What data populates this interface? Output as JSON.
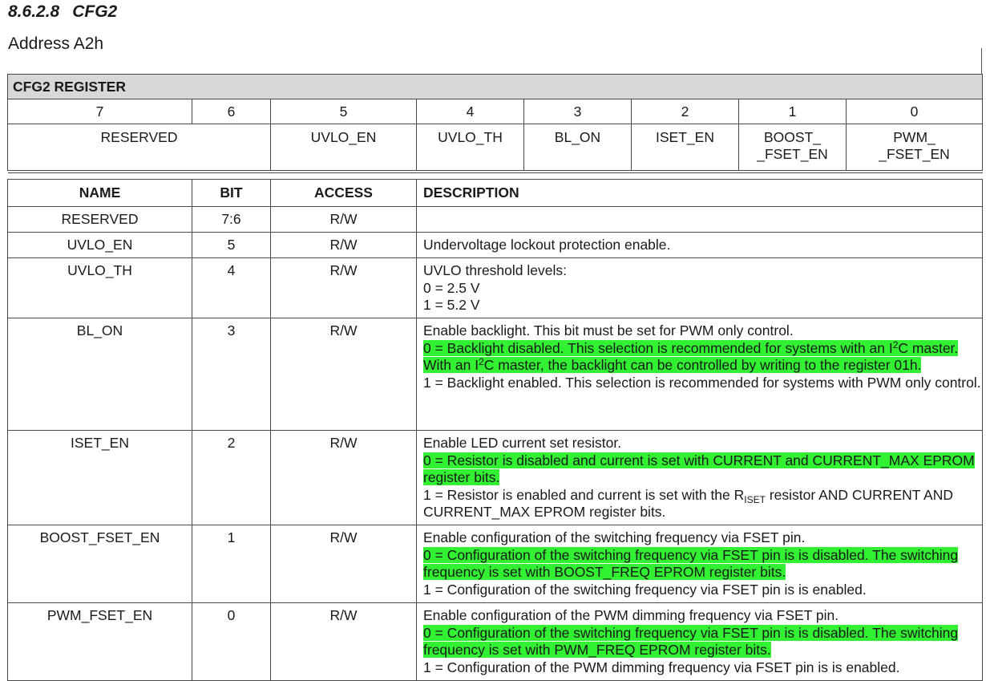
{
  "section": {
    "number": "8.6.2.8",
    "title": "CFG2"
  },
  "address": "Address A2h",
  "register": {
    "title": "CFG2 REGISTER",
    "bits": [
      "7",
      "6",
      "5",
      "4",
      "3",
      "2",
      "1",
      "0"
    ],
    "fields": {
      "reserved": "RESERVED",
      "b5": "UVLO_EN",
      "b4": "UVLO_TH",
      "b3": "BL_ON",
      "b2": "ISET_EN",
      "b1_line1": "BOOST_",
      "b1_line2": "_FSET_EN",
      "b0_line1": "PWM_",
      "b0_line2": "_FSET_EN"
    }
  },
  "table": {
    "headers": {
      "name": "NAME",
      "bit": "BIT",
      "access": "ACCESS",
      "description": "DESCRIPTION"
    },
    "rows": [
      {
        "name": "RESERVED",
        "bit": "7:6",
        "access": "R/W"
      },
      {
        "name": "UVLO_EN",
        "bit": "5",
        "access": "R/W",
        "d1": "Undervoltage lockout protection enable."
      },
      {
        "name": "UVLO_TH",
        "bit": "4",
        "access": "R/W",
        "d1": "UVLO threshold levels:",
        "d2": "0 = 2.5 V",
        "d3": "1 = 5.2 V"
      },
      {
        "name": "BL_ON",
        "bit": "3",
        "access": "R/W",
        "d1": "Enable backlight. This bit must be set for PWM only control.",
        "h1": "0 = Backlight disabled. This selection is recommended for systems with an I",
        "h1_sup": "2",
        "h2": "C master. With an I",
        "h2_sup": "2",
        "h3": "C master, the backlight can be controlled by writing to the register 01h.",
        "d2": "1 = Backlight enabled. This selection is recommended for systems with PWM only control."
      },
      {
        "name": "ISET_EN",
        "bit": "2",
        "access": "R/W",
        "d1": "Enable LED current set resistor.",
        "h1": "0 = Resistor is disabled and current is set with CURRENT and CURRENT_MAX EPROM register bits.",
        "d2a": "1 = Resistor is enabled and current is set with the R",
        "d2sub": "ISET",
        "d2b": " resistor AND CURRENT AND CURRENT_MAX EPROM register bits."
      },
      {
        "name": "BOOST_FSET_EN",
        "bit": "1",
        "access": "R/W",
        "d1": "Enable configuration of the switching frequency via FSET pin.",
        "h1": "0 = Configuration of the switching frequency via FSET pin is is disabled. The switching frequency is set with BOOST_FREQ EPROM register bits.",
        "d2": "1 = Configuration of the switching frequency via FSET pin is is enabled."
      },
      {
        "name": "PWM_FSET_EN",
        "bit": "0",
        "access": "R/W",
        "d1": "Enable configuration of the PWM dimming frequency via FSET pin.",
        "h1": "0 = Configuration of the switching frequency via FSET pin is is disabled. The switching frequency is set with PWM_FREQ EPROM register bits.",
        "d2": "1 = Configuration of the PWM dimming frequency via FSET pin is is enabled."
      }
    ]
  },
  "colors": {
    "highlight": "#32f032",
    "header_bg": "#d8d8d8"
  }
}
